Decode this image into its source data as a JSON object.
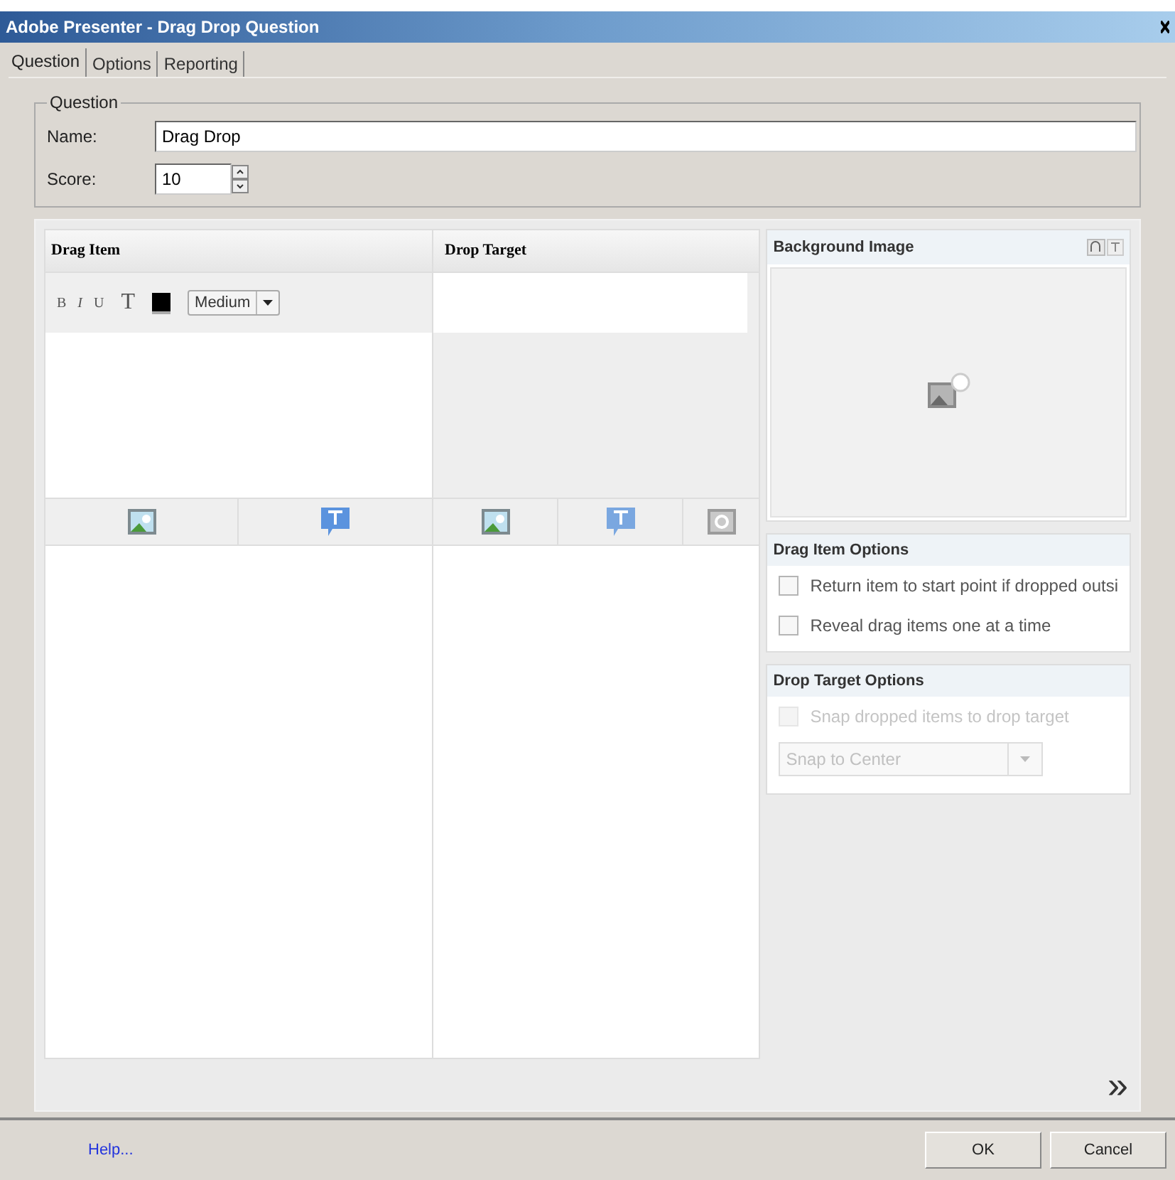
{
  "window": {
    "title": "Adobe Presenter - Drag Drop Question"
  },
  "tabs": [
    {
      "label": "Question",
      "selected": true
    },
    {
      "label": "Options",
      "selected": false
    },
    {
      "label": "Reporting",
      "selected": false
    }
  ],
  "question_group": {
    "title": "Question",
    "name_label": "Name:",
    "name_value": "Drag Drop",
    "score_label": "Score:",
    "score_value": "10"
  },
  "drag_item": {
    "heading": "Drag Item",
    "toolbar": {
      "bold": "B",
      "italic": "I",
      "underline": "U",
      "text_size": "T",
      "font_size": "Medium"
    }
  },
  "drop_target": {
    "heading": "Drop Target"
  },
  "background_image": {
    "heading": "Background Image"
  },
  "drag_item_options": {
    "heading": "Drag Item Options",
    "options": [
      {
        "label": "Return item to start point if dropped outsi",
        "checked": false,
        "disabled": false
      },
      {
        "label": "Reveal drag items one at a time",
        "checked": false,
        "disabled": false
      }
    ]
  },
  "drop_target_options": {
    "heading": "Drop Target Options",
    "options": [
      {
        "label": "Snap dropped items to drop target",
        "checked": false,
        "disabled": true
      }
    ],
    "snap": {
      "value": "Snap to Center",
      "disabled": true
    }
  },
  "next_label": "»",
  "footer": {
    "help": "Help...",
    "buttons": [
      "OK",
      "Cancel"
    ]
  }
}
